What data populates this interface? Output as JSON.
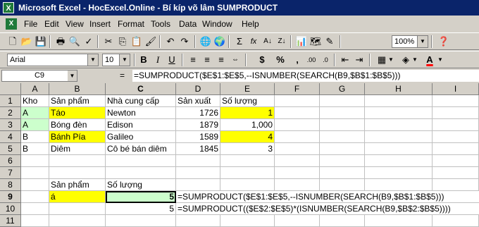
{
  "window": {
    "title": "Microsoft Excel - HocExcel.Online - Bí kíp võ lâm SUMPRODUCT",
    "app_icon": "excel-icon"
  },
  "menu": [
    "File",
    "Edit",
    "View",
    "Insert",
    "Format",
    "Tools",
    "Data",
    "Window",
    "Help"
  ],
  "toolbar": {
    "zoom": "100%",
    "font_name": "Arial",
    "font_size": "10",
    "bold": "B",
    "italic": "I",
    "underline": "U",
    "sum": "Σ",
    "fx": "fx",
    "currency": "$",
    "percent": "%",
    "comma": ",",
    "font_color": "#ff0000",
    "fill_color": "#ffff00"
  },
  "formula_bar": {
    "name_box": "C9",
    "equals": "=",
    "formula": "=SUMPRODUCT($E$1:$E$5,--ISNUMBER(SEARCH(B9,$B$1:$B$5)))"
  },
  "columns": [
    "A",
    "B",
    "C",
    "D",
    "E",
    "F",
    "G",
    "H",
    "I"
  ],
  "rows": [
    "1",
    "2",
    "3",
    "4",
    "5",
    "6",
    "7",
    "8",
    "9",
    "10",
    "11"
  ],
  "cells": {
    "A1": "Kho",
    "B1": "Sản phẩm",
    "C1": "Nhà cung cấp",
    "D1": "Sản xuất",
    "E1": "Số lượng",
    "A2": "A",
    "B2": "Táo",
    "C2": "Newton",
    "D2": "1726",
    "E2": "1",
    "A3": "A",
    "B3": "Bóng đèn",
    "C3": "Edison",
    "D3": "1879",
    "E3": "1,000",
    "A4": "B",
    "B4": "Bánh Pía",
    "C4": "Galileo",
    "D4": "1589",
    "E4": "4",
    "A5": "B",
    "B5": "Diêm",
    "C5": "Cô bé bán diêm",
    "D5": "1845",
    "E5": "3",
    "B8": "Sản phẩm",
    "C8": "Số lượng",
    "B9": "á",
    "C9": "5",
    "D9": "=SUMPRODUCT($E$1:$E$5,--ISNUMBER(SEARCH(B9,$B$1:$B$5)))",
    "C10": "5",
    "D10": "=SUMPRODUCT(($E$2:$E$5)*(ISNUMBER(SEARCH(B9,$B$2:$B$5))))"
  },
  "selected_cell": "C9"
}
